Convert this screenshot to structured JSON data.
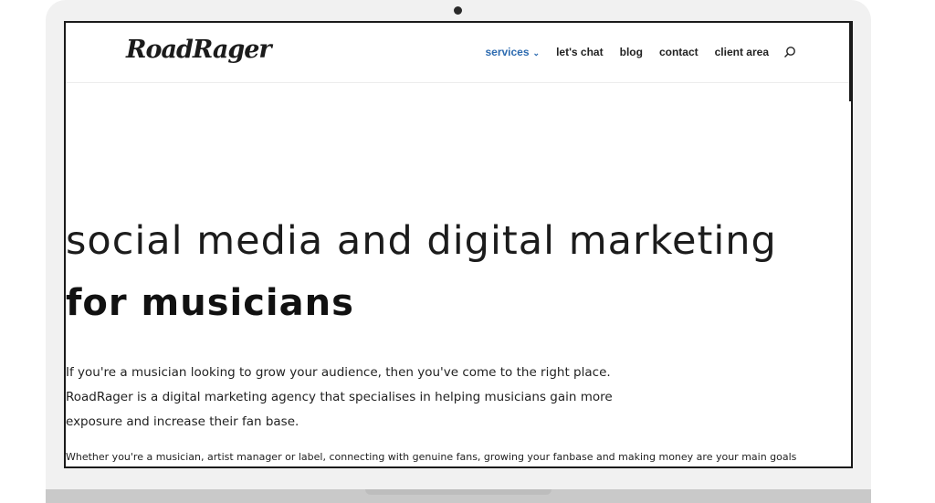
{
  "nav": {
    "logo_text": "RoadRager",
    "items": [
      {
        "label": "services"
      },
      {
        "label": "let's chat"
      },
      {
        "label": "blog"
      },
      {
        "label": "contact"
      },
      {
        "label": "client area"
      }
    ]
  },
  "hero": {
    "headline": "social media and digital marketing",
    "subheadline": "for musicians",
    "body": [
      "If you're a musician looking to grow your audience, then you've come to the right place.",
      "RoadRager is a digital marketing agency that specialises in helping musicians gain more",
      "exposure and increase their fan base."
    ],
    "footer": "Whether you're a musician, artist manager or label, connecting with genuine fans, growing your fanbase and making money are your main goals"
  },
  "colors": {
    "accent": "#2d6bb0",
    "text": "#1c1c1c",
    "frame": "#f1f1f1"
  },
  "icons": {
    "search": "search-icon",
    "dropdown": "chevron-down-icon",
    "camera": "camera-icon"
  }
}
